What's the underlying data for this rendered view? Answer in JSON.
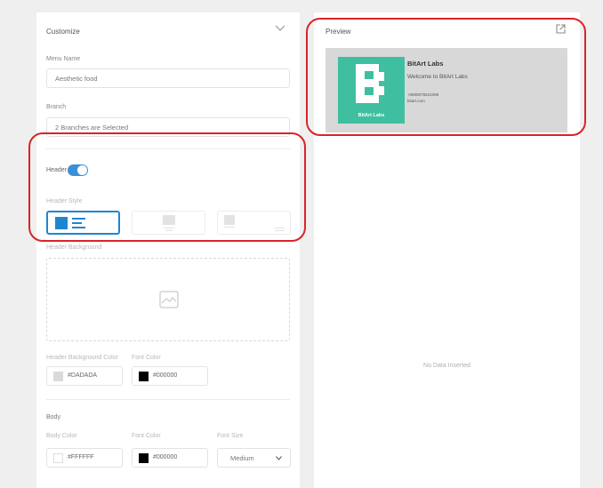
{
  "customize": {
    "title": "Customize",
    "menu_name_label": "Menu Name",
    "menu_name_value": "Aesthetic food",
    "branch_label": "Branch",
    "branch_value": "2 Branches are Selected",
    "header_label": "Header",
    "header_enabled": true,
    "header_style_label": "Header Style",
    "header_bg_label": "Header Background",
    "header_bg_color_label": "Header Background Color",
    "header_bg_color_value": "#DADADA",
    "header_font_color_label": "Font Color",
    "header_font_color_value": "#000000",
    "body_label": "Body",
    "body_color_label": "Body Color",
    "body_color_value": "#FFFFFF",
    "body_font_color_label": "Font Color",
    "body_font_color_value": "#000000",
    "font_size_label": "Font Size",
    "font_size_value": "Medium"
  },
  "preview": {
    "title": "Preview",
    "logo_text": "BitArt Labs",
    "company_name": "BitArt Labs",
    "welcome": "Welcome to BitArt Labs",
    "phone": "+0808075521098",
    "site": "bitart.com",
    "no_data": "No Data Inserted",
    "card_color": "#DADADA",
    "logo_color": "#3fbfa0"
  },
  "colors": {
    "accent": "#1e86d0",
    "highlight": "#d9232a"
  }
}
